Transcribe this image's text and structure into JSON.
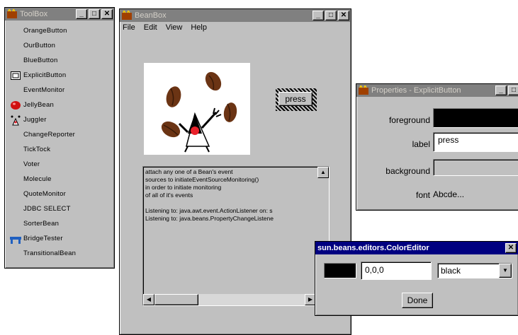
{
  "toolbox": {
    "title": "ToolBox",
    "items": [
      {
        "label": "OrangeButton",
        "icon": "none"
      },
      {
        "label": "OurButton",
        "icon": "none"
      },
      {
        "label": "BlueButton",
        "icon": "none"
      },
      {
        "label": "ExplicitButton",
        "icon": "button-square-icon"
      },
      {
        "label": "EventMonitor",
        "icon": "none"
      },
      {
        "label": "JellyBean",
        "icon": "jellybean-icon"
      },
      {
        "label": "Juggler",
        "icon": "juggler-icon"
      },
      {
        "label": "ChangeReporter",
        "icon": "none"
      },
      {
        "label": "TickTock",
        "icon": "none"
      },
      {
        "label": "Voter",
        "icon": "none"
      },
      {
        "label": "Molecule",
        "icon": "none"
      },
      {
        "label": "QuoteMonitor",
        "icon": "none"
      },
      {
        "label": "JDBC SELECT",
        "icon": "none"
      },
      {
        "label": "SorterBean",
        "icon": "none"
      },
      {
        "label": "BridgeTester",
        "icon": "bridge-icon"
      },
      {
        "label": "TransitionalBean",
        "icon": "none"
      }
    ]
  },
  "beanbox": {
    "title": "BeanBox",
    "menu": [
      "File",
      "Edit",
      "View",
      "Help"
    ],
    "press_button_label": "press",
    "monitor_lines": [
      "attach any one of a Bean's event",
      "sources to initiateEventSourceMonitoring()",
      "in order to initiate monitoring",
      "of all of it's events",
      "",
      "Listening to: java.awt.event.ActionListener on: s",
      "Listening to: java.beans.PropertyChangeListene"
    ]
  },
  "properties": {
    "title": "Properties - ExplicitButton",
    "foreground_label": "foreground",
    "label_label": "label",
    "label_value": "press",
    "background_label": "background",
    "font_label": "font",
    "font_value": "Abcde..."
  },
  "color_editor": {
    "title": "sun.beans.editors.ColorEditor",
    "rgb_value": "0,0,0",
    "selected_color": "black",
    "done_label": "Done",
    "swatch_color": "#000000"
  },
  "colors": {
    "window_bg": "#c0c0c0",
    "active_title": "#000080",
    "inactive_title": "#808080"
  }
}
